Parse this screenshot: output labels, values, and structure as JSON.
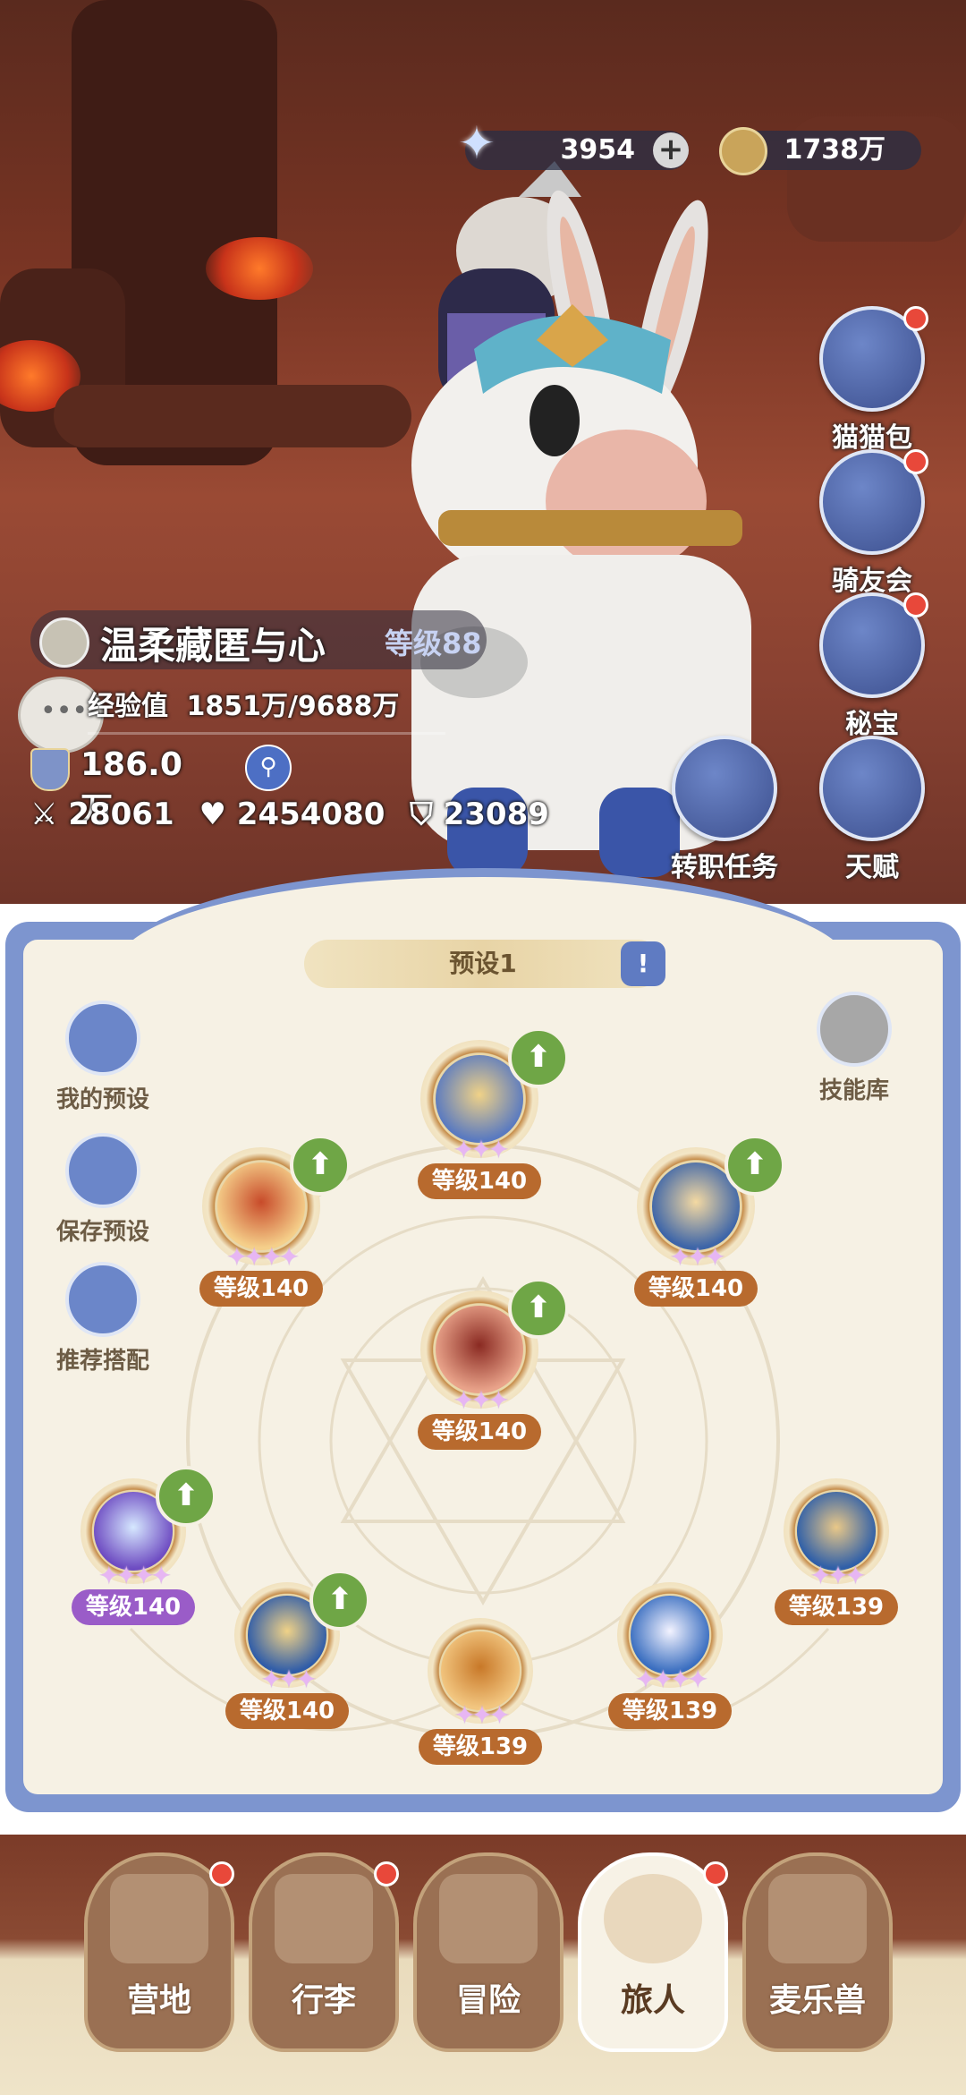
{
  "currency": {
    "stars": "3954",
    "coins": "1738万"
  },
  "side_menu": [
    {
      "label": "猫猫包",
      "icon": "cat-bag-icon"
    },
    {
      "label": "骑友会",
      "icon": "horse-head-icon"
    },
    {
      "label": "秘宝",
      "icon": "treasure-chest-icon"
    },
    {
      "label": "天赋",
      "icon": "talent-head-icon"
    }
  ],
  "job_task": {
    "label": "转职任务"
  },
  "player": {
    "name": "温柔藏匿与心",
    "level": "等级88",
    "exp_label": "经验值",
    "exp_value": "1851万/9688万",
    "power": "186.0万",
    "attack": "28061",
    "hp": "2454080",
    "defense": "23089"
  },
  "panel": {
    "preset_name": "预设1",
    "skill_library": "技能库",
    "left_buttons": [
      "我的预设",
      "保存预设",
      "推荐搭配"
    ]
  },
  "skills": [
    {
      "level": "等级140",
      "stars": "4",
      "upgradable": true
    },
    {
      "level": "等级140",
      "stars": "3",
      "upgradable": true
    },
    {
      "level": "等级140",
      "stars": "3",
      "upgradable": true
    },
    {
      "level": "等级140",
      "stars": "3",
      "upgradable": true
    },
    {
      "level": "等级140",
      "stars": "4",
      "upgradable": true
    },
    {
      "level": "等级140",
      "stars": "3",
      "upgradable": true
    },
    {
      "level": "等级139",
      "stars": "3",
      "upgradable": false
    },
    {
      "level": "等级139",
      "stars": "4",
      "upgradable": false
    },
    {
      "level": "等级139",
      "stars": "3",
      "upgradable": false
    }
  ],
  "bottom_nav": [
    {
      "label": "营地",
      "badge": true,
      "active": false
    },
    {
      "label": "行李",
      "badge": true,
      "active": false
    },
    {
      "label": "冒险",
      "badge": false,
      "active": false
    },
    {
      "label": "旅人",
      "badge": true,
      "active": true
    },
    {
      "label": "麦乐兽",
      "badge": false,
      "active": false
    }
  ],
  "colors": {
    "panel_frame": "#7d95cf",
    "panel_bg": "#f6f1e4",
    "level_badge": "#b86a2e",
    "upgrade_green": "#6fa646",
    "badge_red": "#e8483a"
  }
}
